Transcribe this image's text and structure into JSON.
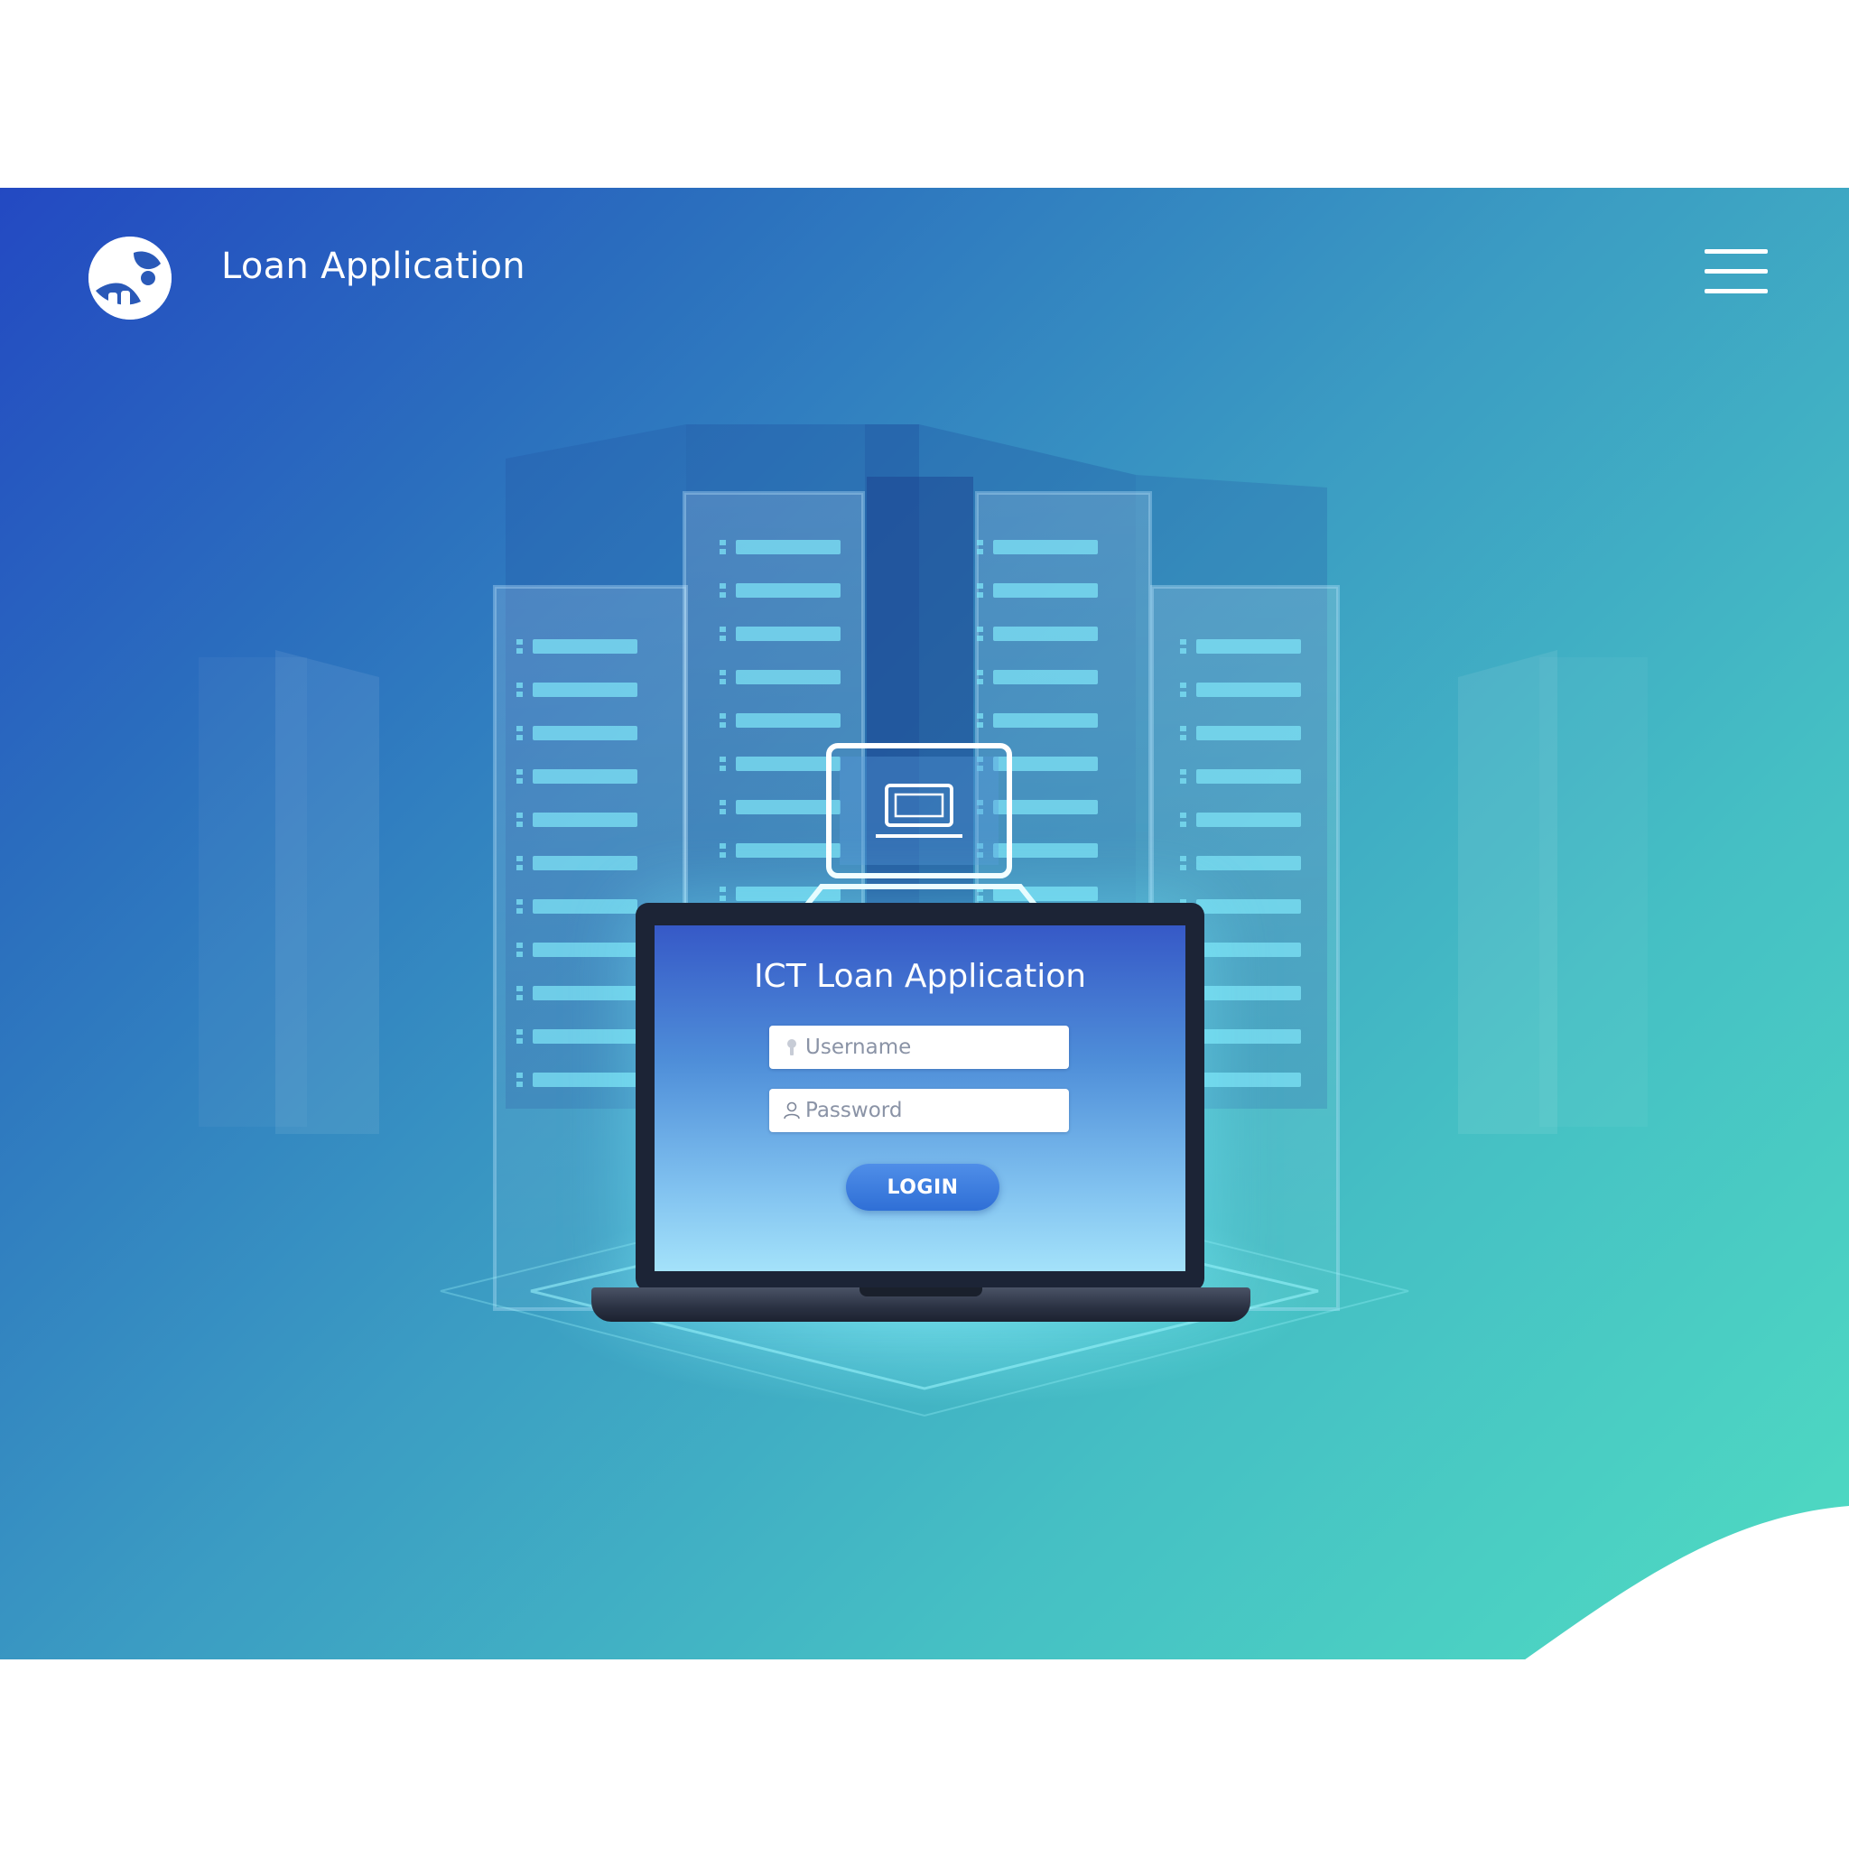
{
  "header": {
    "title": "Loan Application",
    "logo_icon": "globe-hand-logo",
    "menu_icon": "hamburger-menu-icon"
  },
  "login_card": {
    "title": "ICT Loan Application",
    "username_placeholder": "Username",
    "password_placeholder": "Password",
    "login_label": "LOGIN",
    "username_icon": "key-icon",
    "password_icon": "user-icon"
  },
  "colors": {
    "gradient_start": "#2349c2",
    "gradient_end": "#4fdcc2",
    "button": "#3a7fe0",
    "laptop_frame": "#1c2436"
  }
}
